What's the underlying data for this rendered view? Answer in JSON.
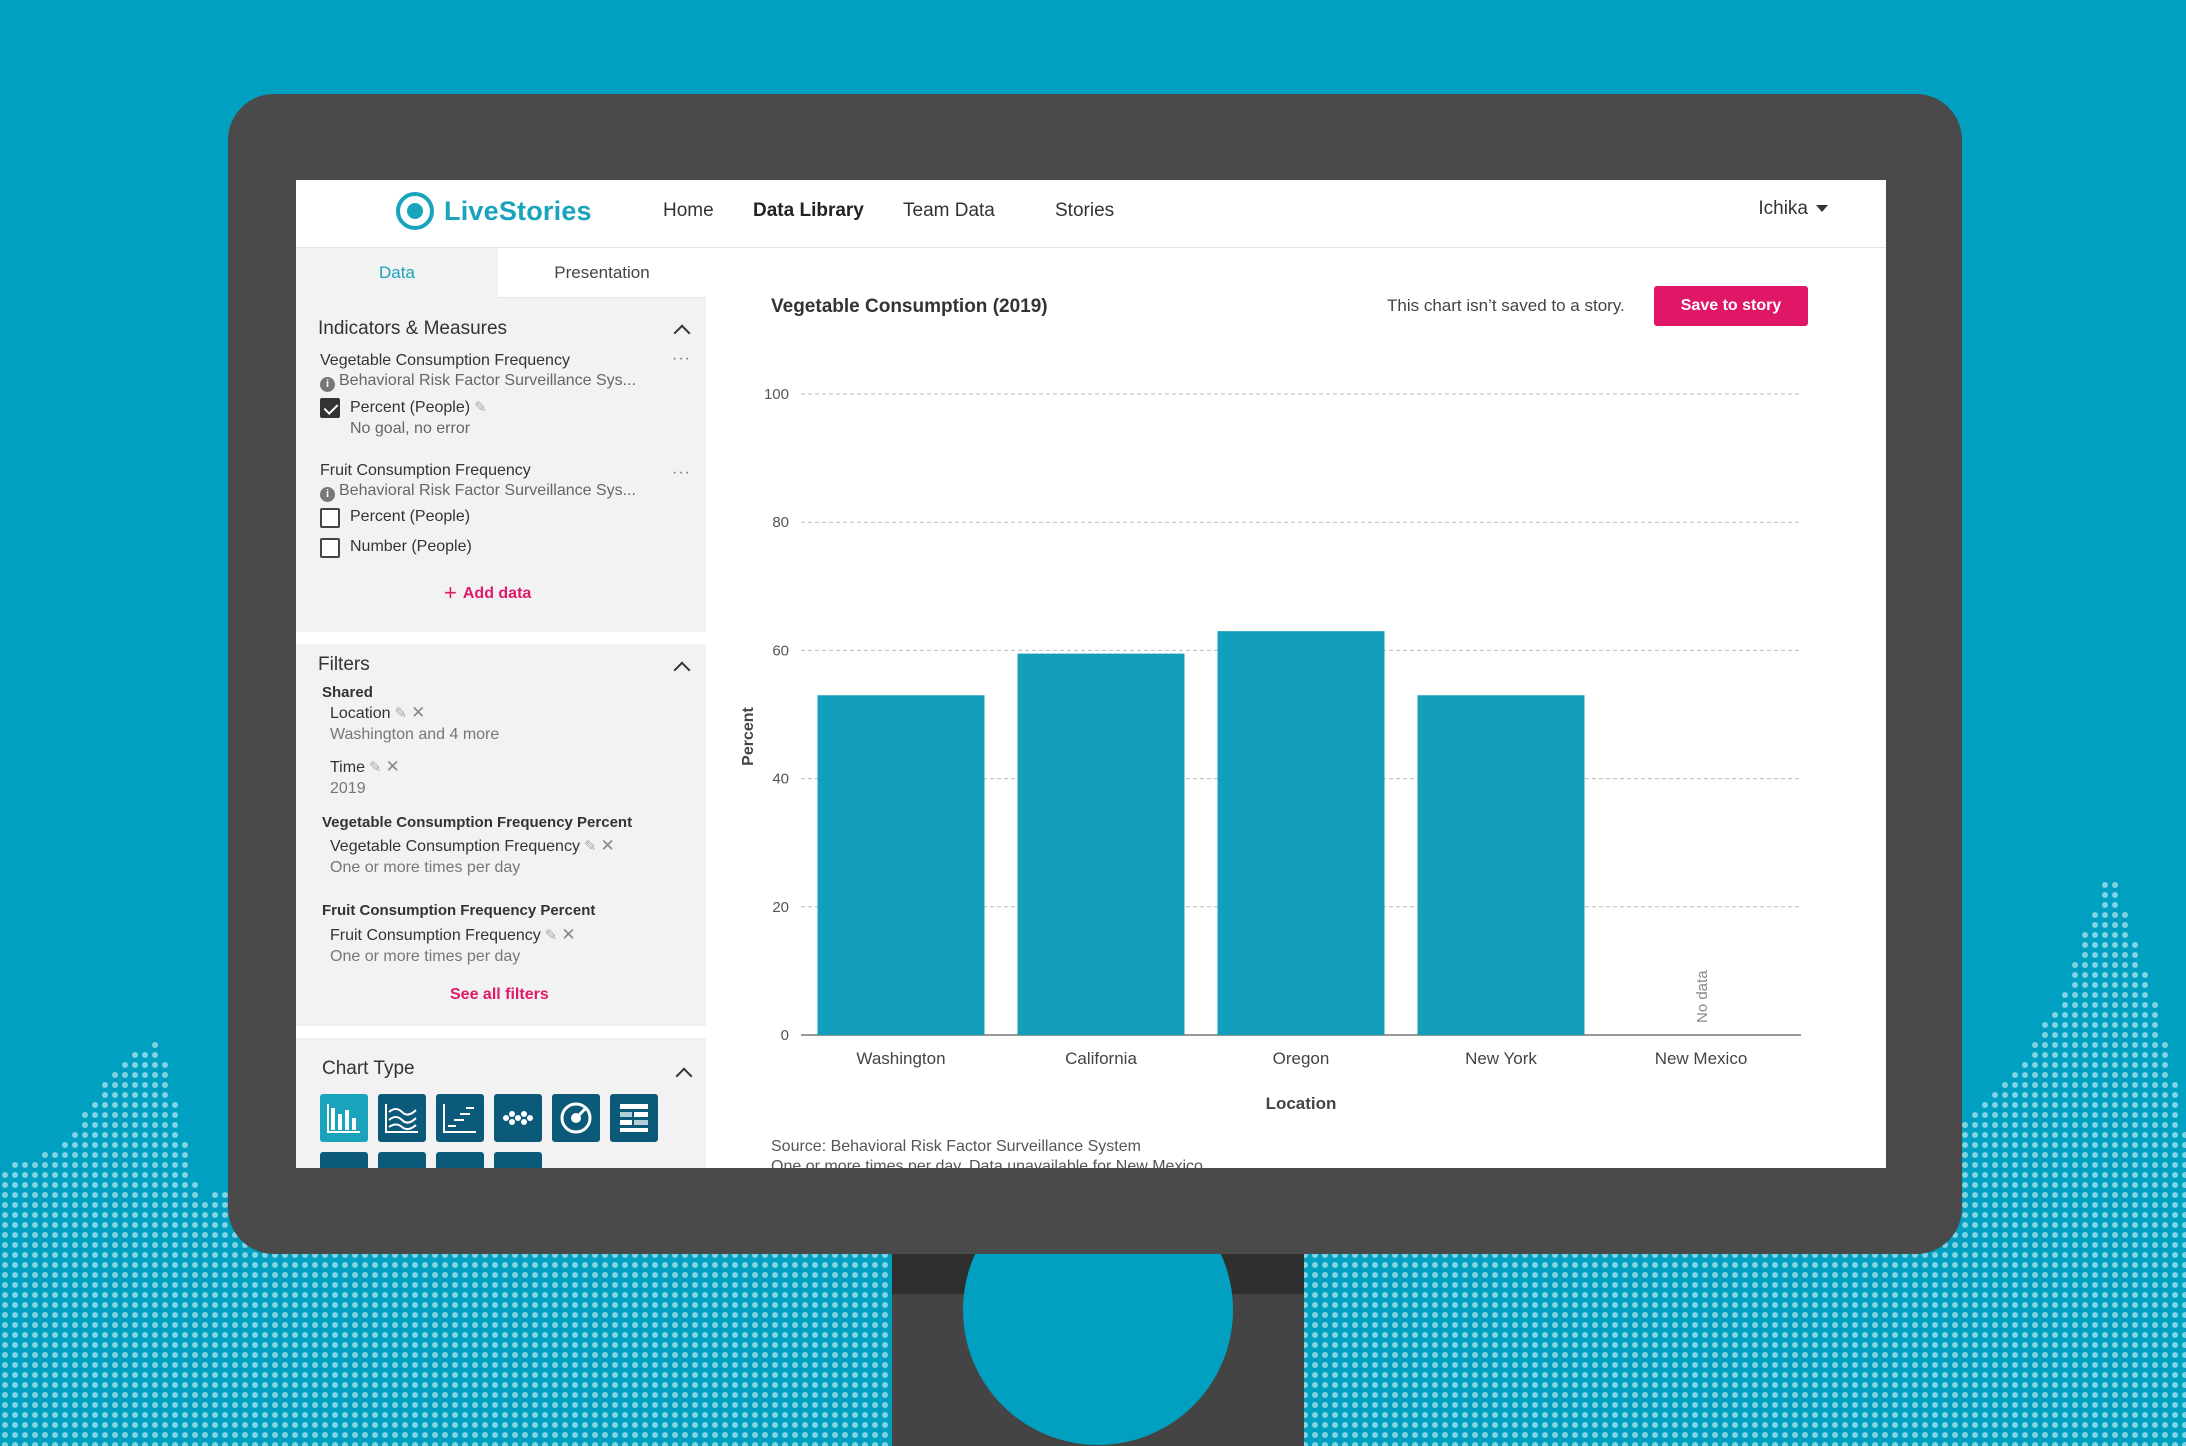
{
  "nav": {
    "logo": "LiveStories",
    "items": [
      "Home",
      "Data Library",
      "Team Data",
      "Stories"
    ],
    "user": "Ichika"
  },
  "panel": {
    "tabs": [
      "Data",
      "Presentation"
    ],
    "indicators_title": "Indicators & Measures",
    "indicators": [
      {
        "title": "Vegetable Consumption Frequency",
        "source": "Behavioral Risk Factor Surveillance Sys...",
        "measures": [
          {
            "label": "Percent (People)",
            "checked": true,
            "note": "No goal, no error"
          }
        ]
      },
      {
        "title": "Fruit Consumption Frequency",
        "source": "Behavioral Risk Factor Surveillance Sys...",
        "measures": [
          {
            "label": "Percent (People)",
            "checked": false
          },
          {
            "label": "Number (People)",
            "checked": false
          }
        ]
      }
    ],
    "add_data": "Add data",
    "filters_title": "Filters",
    "filters": {
      "shared_label": "Shared",
      "location_label": "Location",
      "location_value": "Washington and 4 more",
      "time_label": "Time",
      "time_value": "2019",
      "veg_group": "Vegetable Consumption Frequency Percent",
      "veg_item": "Vegetable Consumption Frequency",
      "veg_value": "One or more times per day",
      "fruit_group": "Fruit Consumption Frequency Percent",
      "fruit_item": "Fruit Consumption Frequency",
      "fruit_value": "One or more times per day"
    },
    "see_all_filters": "See all filters",
    "chart_type_title": "Chart Type"
  },
  "chart_header": {
    "title": "Vegetable Consumption (2019)",
    "status": "This chart isn’t saved to a story.",
    "save_label": "Save to story"
  },
  "chart_data": {
    "type": "bar",
    "title": "Vegetable Consumption (2019)",
    "categories": [
      "Washington",
      "California",
      "Oregon",
      "New York",
      "New Mexico"
    ],
    "values": [
      53,
      59.5,
      63,
      53,
      null
    ],
    "missing_label": "No data",
    "xlabel": "Location",
    "ylabel": "Percent",
    "ylim": [
      0,
      100
    ],
    "yticks": [
      0,
      20,
      40,
      60,
      80,
      100
    ],
    "grid": true,
    "bar_color": "#139fbb"
  },
  "footer": {
    "source": "Source: Behavioral Risk Factor Surveillance System",
    "note": "One or more times per day. Data unavailable for New Mexico."
  },
  "colors": {
    "background": "#02a0c0",
    "accent": "#1aa3bd",
    "action": "#e01766",
    "monitor": "#4a4a4a"
  }
}
